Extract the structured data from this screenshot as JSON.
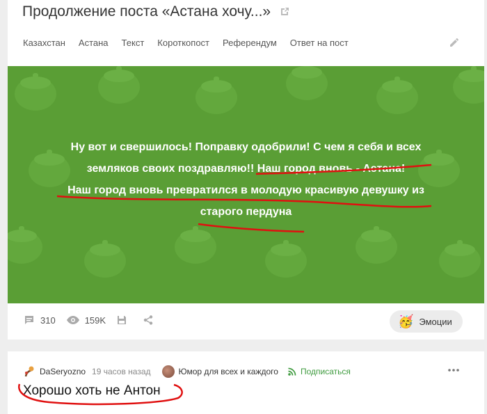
{
  "post": {
    "title": "Продолжение поста «Астана хочу...»",
    "tags": [
      "Казахстан",
      "Астана",
      "Текст",
      "Короткопост",
      "Референдум",
      "Ответ на пост"
    ],
    "image_text": [
      "Ну вот и свершилось! Поправку одобрили! С чем я себя и всех",
      "земляков своих поздравляю!! Наш город вновь - Астана!",
      "Наш город вновь превратился в молодую красивую девушку из",
      "старого пердуна"
    ],
    "comments_count": "310",
    "views_count": "159K",
    "emotions_label": "Эмоции",
    "emotions_emoji": "🥳"
  },
  "comment": {
    "author": "DaSeryozno",
    "time": "19 часов назад",
    "community": "Юмор для всех и каждого",
    "subscribe_label": "Подписаться",
    "text": "Хорошо хоть не Антон"
  },
  "colors": {
    "image_bg": "#5a9e35",
    "subscribe": "#3f9b3f",
    "annotation": "#e01010"
  },
  "icons": [
    "external-link-icon",
    "pencil-icon",
    "comment-icon",
    "eye-icon",
    "save-icon",
    "share-icon",
    "rss-icon",
    "more-dots-icon"
  ]
}
